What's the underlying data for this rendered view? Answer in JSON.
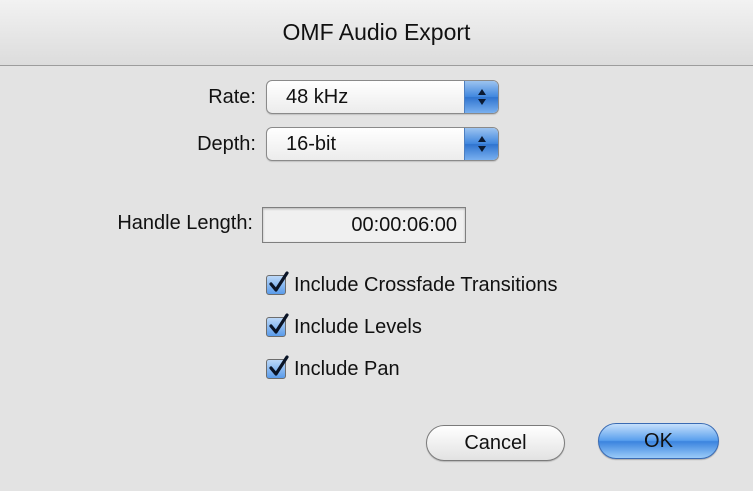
{
  "window": {
    "title": "OMF Audio Export"
  },
  "rate": {
    "label": "Rate:",
    "value": "48 kHz"
  },
  "depth": {
    "label": "Depth:",
    "value": "16-bit"
  },
  "handle_length": {
    "label": "Handle Length:",
    "value": "00:00:06:00"
  },
  "options": [
    {
      "label": "Include Crossfade Transitions",
      "checked": true
    },
    {
      "label": "Include Levels",
      "checked": true
    },
    {
      "label": "Include Pan",
      "checked": true
    }
  ],
  "buttons": {
    "cancel": "Cancel",
    "ok": "OK"
  },
  "colors": {
    "accent": "#3b84df",
    "background": "#e3e3e3"
  },
  "icons": {
    "popup": "up-down-arrows-icon",
    "check": "checkmark-icon"
  }
}
